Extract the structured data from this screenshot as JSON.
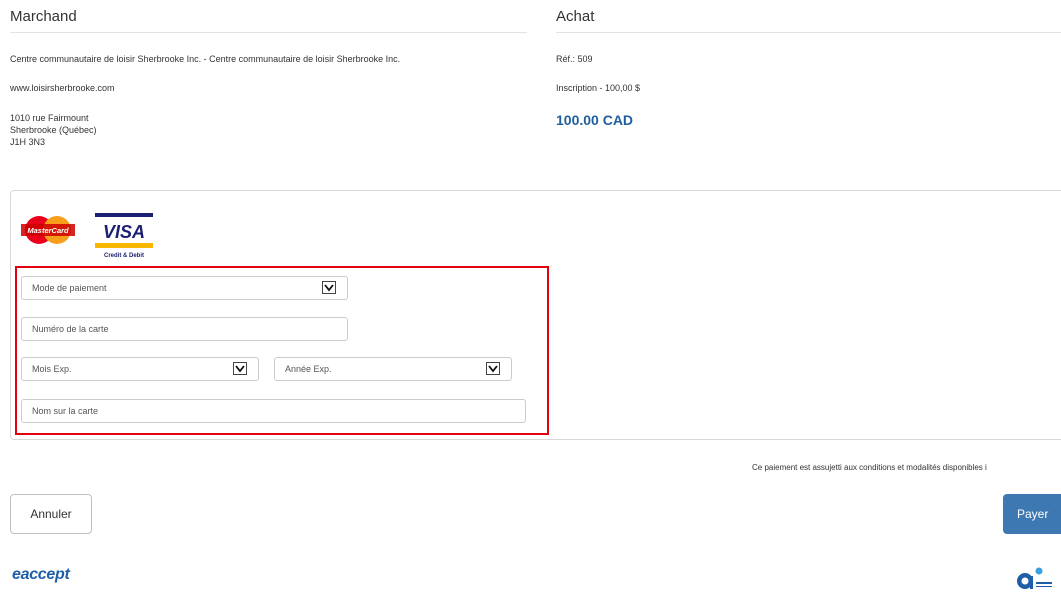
{
  "merchant": {
    "title": "Marchand",
    "name": "Centre communautaire de loisir Sherbrooke Inc. - Centre communautaire de loisir Sherbrooke Inc.",
    "website": "www.loisirsherbrooke.com",
    "address_line1": "1010 rue Fairmount",
    "address_line2": "Sherbrooke (Québec)",
    "postal_code": "J1H 3N3"
  },
  "purchase": {
    "title": "Achat",
    "reference": "Réf.: 509",
    "item": "Inscription - 100,00 $",
    "total": "100.00 CAD"
  },
  "card_logos": {
    "mastercard": "MasterCard",
    "visa": "VISA",
    "visa_sub": "Credit & Debit"
  },
  "form": {
    "payment_mode": "Mode de paiement",
    "card_number_placeholder": "Numéro de la carte",
    "exp_month": "Mois Exp.",
    "exp_year": "Année Exp.",
    "card_name_placeholder": "Nom sur la carte"
  },
  "footer": {
    "terms": "Ce paiement est assujetti aux conditions et modalités disponibles i",
    "cancel_label": "Annuler",
    "pay_label": "Payer",
    "brand": "eaccept"
  },
  "colors": {
    "accent": "#3e78b2",
    "highlight": "#e3000f",
    "total": "#1f5f9e"
  }
}
